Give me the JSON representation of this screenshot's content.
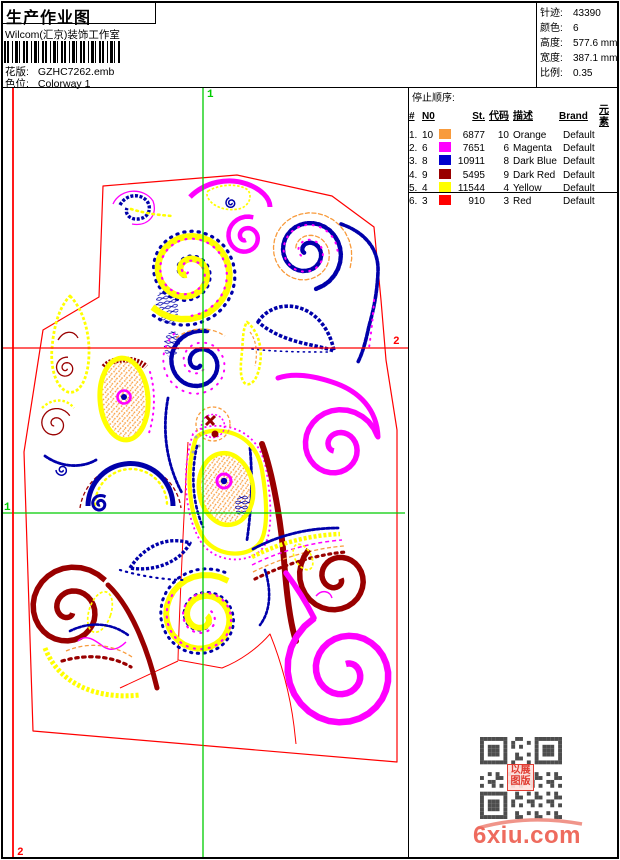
{
  "header": {
    "title": "生产作业图",
    "studio": "Wilcom(汇京)装饰工作室",
    "design_label": "花版:",
    "design_value": "GZHC7262.emb",
    "colorway_label": "色位:",
    "colorway_value": "Colorway 1"
  },
  "info": {
    "rows": [
      {
        "label": "针迹:",
        "value": "43390"
      },
      {
        "label": "颜色:",
        "value": "6"
      },
      {
        "label": "高度:",
        "value": "577.6 mm"
      },
      {
        "label": "宽度:",
        "value": "387.1 mm"
      },
      {
        "label": "比例:",
        "value": "0.35"
      }
    ]
  },
  "stop_sequence": {
    "title": "停止顺序:",
    "columns": [
      "#",
      "N0",
      "St.",
      "代码",
      "描述",
      "Brand",
      "元素"
    ],
    "rows": [
      {
        "idx": "1.",
        "needle": "10",
        "swatch": "#F89B3C",
        "stitches": "6877",
        "code": "10",
        "desc": "Orange",
        "brand": "Default"
      },
      {
        "idx": "2.",
        "needle": "6",
        "swatch": "#FF00FF",
        "stitches": "7651",
        "code": "6",
        "desc": "Magenta",
        "brand": "Default"
      },
      {
        "idx": "3.",
        "needle": "8",
        "swatch": "#0000CC",
        "stitches": "10911",
        "code": "8",
        "desc": "Dark Blue",
        "brand": "Default"
      },
      {
        "idx": "4.",
        "needle": "9",
        "swatch": "#990000",
        "stitches": "5495",
        "code": "9",
        "desc": "Dark Red",
        "brand": "Default"
      },
      {
        "idx": "5.",
        "needle": "4",
        "swatch": "#FFFF00",
        "stitches": "11544",
        "code": "4",
        "desc": "Yellow",
        "brand": "Default"
      },
      {
        "idx": "6.",
        "needle": "3",
        "swatch": "#FF0000",
        "stitches": "910",
        "code": "3",
        "desc": "Red",
        "brand": "Default"
      }
    ]
  },
  "crosshairs": {
    "start_label": "1",
    "end_label": "2",
    "start_color": "#00CC00",
    "end_color": "#FF0000"
  },
  "threads": {
    "orange": "#F89B3C",
    "magenta": "#FF00FF",
    "blue": "#0000AA",
    "darkred": "#990000",
    "yellow": "#FFFF00",
    "red": "#FF0000",
    "grey": "#AAAAAA"
  },
  "watermark": {
    "text": "6xiu.com",
    "color": "#EE6B5E"
  },
  "qr_stamp": {
    "line1": "以展",
    "line2": "图版"
  }
}
